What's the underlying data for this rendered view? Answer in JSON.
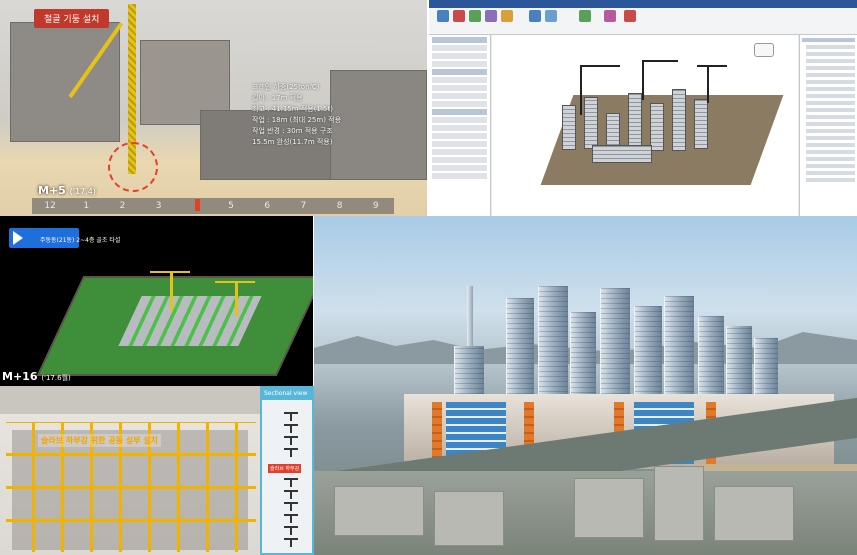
{
  "panel1": {
    "title": "철골 기둥 설치",
    "info_lines": [
      "크레인 하중(25ton/C)",
      "길이 : 17m 적용",
      "최고 : 41.15m 적용(1.5t)",
      "작업 : 18m (최대 25m) 적용",
      "작업 반경 : 30m 적용 구조",
      "15.5m 완성(11.7m 적용)"
    ],
    "month_label": "M+5",
    "month_sub": "('17.4)",
    "timeline": [
      "12",
      "1",
      "2",
      "3",
      "4",
      "5",
      "6",
      "7",
      "8",
      "9"
    ],
    "active_tick": "4"
  },
  "panel3": {
    "badge_text": "주동동(21동) 2~4층 골조 타설",
    "month_label": "M+16",
    "month_sub": "('17.6월)"
  },
  "panel4": {
    "label": "슬라브 하부강 위한 공동 성부 설치"
  },
  "panel5": {
    "header": "Sectional view",
    "tag": "슬라브 하부강"
  },
  "colors": {
    "accent_red": "#e43f2b",
    "crane_yellow": "#e4c21a",
    "badge_blue": "#1e6fd9",
    "section_blue": "#58b7d9"
  }
}
